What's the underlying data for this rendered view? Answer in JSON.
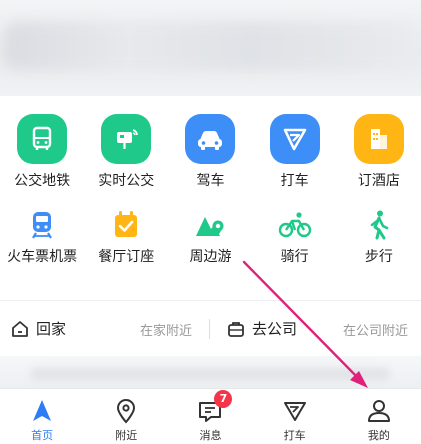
{
  "services": {
    "row1": [
      {
        "label": "公交地铁",
        "icon": "bus-icon"
      },
      {
        "label": "实时公交",
        "icon": "realtime-bus-icon"
      },
      {
        "label": "驾车",
        "icon": "car-icon"
      },
      {
        "label": "打车",
        "icon": "taxi-icon"
      },
      {
        "label": "订酒店",
        "icon": "hotel-icon"
      }
    ],
    "row2": [
      {
        "label": "火车票机票",
        "icon": "train-icon"
      },
      {
        "label": "餐厅订座",
        "icon": "restaurant-icon"
      },
      {
        "label": "周边游",
        "icon": "nearby-tour-icon"
      },
      {
        "label": "骑行",
        "icon": "bicycle-icon"
      },
      {
        "label": "步行",
        "icon": "walking-icon"
      }
    ]
  },
  "commute": {
    "home": {
      "title": "回家",
      "subtitle": "在家附近"
    },
    "work": {
      "title": "去公司",
      "subtitle": "在公司附近"
    }
  },
  "tabbar": {
    "items": [
      {
        "label": "首页",
        "icon": "navigation-arrow-icon",
        "active": true
      },
      {
        "label": "附近",
        "icon": "location-pin-icon"
      },
      {
        "label": "消息",
        "icon": "message-icon",
        "badge": "7"
      },
      {
        "label": "打车",
        "icon": "taxi-icon"
      },
      {
        "label": "我的",
        "icon": "user-icon"
      }
    ]
  },
  "colors": {
    "green": "#1fc98a",
    "blue": "#3e8ef7",
    "orange": "#ffb514",
    "active": "#2e7cf6",
    "badge": "#f5344a",
    "arrow": "#e0217a"
  }
}
